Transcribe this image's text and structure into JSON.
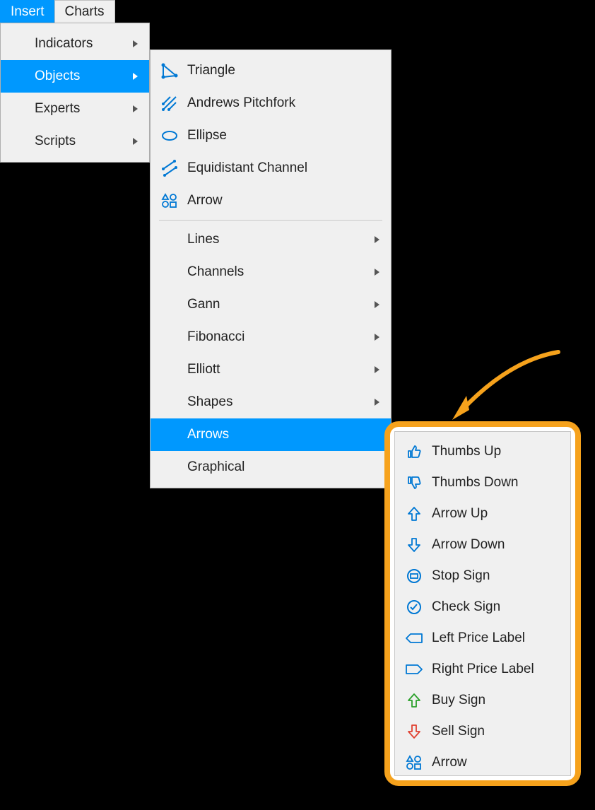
{
  "tabs": {
    "insert": "Insert",
    "charts": "Charts"
  },
  "menu1": {
    "indicators": "Indicators",
    "objects": "Objects",
    "experts": "Experts",
    "scripts": "Scripts"
  },
  "menu2": {
    "tools": {
      "triangle": "Triangle",
      "andrews": "Andrews Pitchfork",
      "ellipse": "Ellipse",
      "equi": "Equidistant Channel",
      "arrow": "Arrow"
    },
    "cats": {
      "lines": "Lines",
      "channels": "Channels",
      "gann": "Gann",
      "fibo": "Fibonacci",
      "elliott": "Elliott",
      "shapes": "Shapes",
      "arrows": "Arrows",
      "graphical": "Graphical"
    }
  },
  "menu3": {
    "thumbs_up": "Thumbs Up",
    "thumbs_down": "Thumbs Down",
    "arrow_up": "Arrow Up",
    "arrow_down": "Arrow Down",
    "stop": "Stop Sign",
    "check": "Check Sign",
    "left_label": "Left Price Label",
    "right_label": "Right Price Label",
    "buy": "Buy Sign",
    "sell": "Sell Sign",
    "arrow": "Arrow"
  },
  "colors": {
    "accent": "#0098fe",
    "callout": "#f6a21c",
    "green": "#2aa02a",
    "red": "#e04030"
  }
}
